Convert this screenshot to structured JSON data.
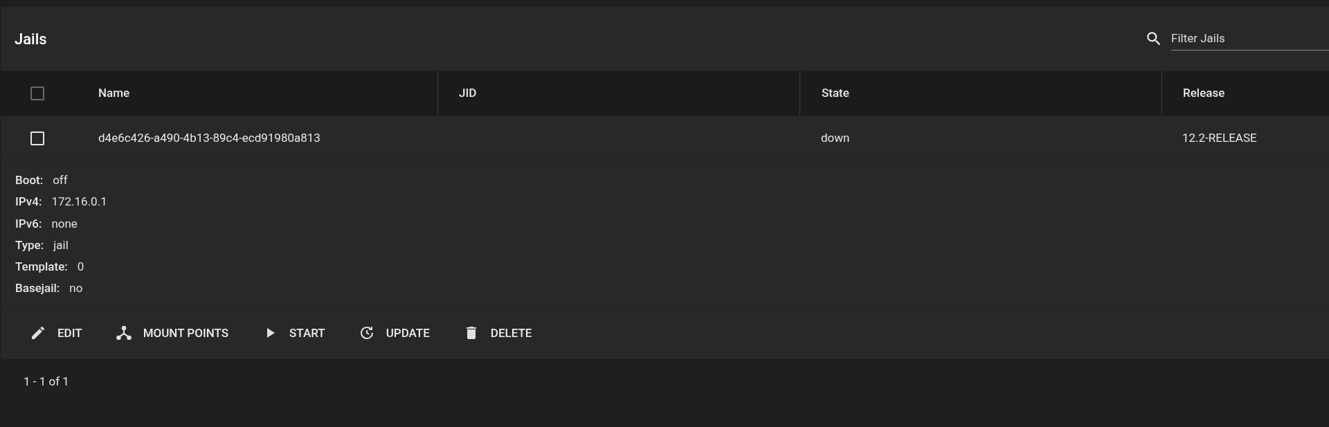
{
  "title": "Jails",
  "search": {
    "placeholder": "Filter Jails"
  },
  "table": {
    "select_all": {
      "checked": false,
      "disabled": true
    },
    "columns": [
      "Name",
      "JID",
      "State",
      "Release"
    ],
    "rows": [
      {
        "checked": false,
        "cells": [
          "d4e6c426-a490-4b13-89c4-ecd91980a813",
          "",
          "down",
          "12.2-RELEASE"
        ],
        "expanded": true,
        "details": [
          {
            "label": "Boot:",
            "value": "off"
          },
          {
            "label": "IPv4:",
            "value": "172.16.0.1"
          },
          {
            "label": "IPv6:",
            "value": "none"
          },
          {
            "label": "Type:",
            "value": "jail"
          },
          {
            "label": "Template:",
            "value": "0"
          },
          {
            "label": "Basejail:",
            "value": "no"
          }
        ],
        "actions": [
          {
            "kind": "edit",
            "label": "EDIT"
          },
          {
            "kind": "mount",
            "label": "MOUNT POINTS"
          },
          {
            "kind": "start",
            "label": "START"
          },
          {
            "kind": "update",
            "label": "UPDATE"
          },
          {
            "kind": "delete",
            "label": "DELETE"
          }
        ]
      }
    ]
  },
  "pagination": "1 - 1 of 1"
}
